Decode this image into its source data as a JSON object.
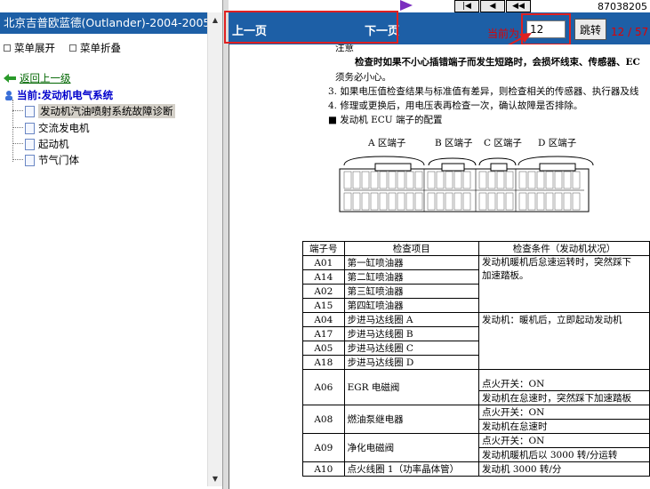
{
  "sidebar": {
    "title": "北京吉普欧蓝德(Outlander)-2004-2005",
    "expand_label": "菜单展开",
    "collapse_label": "菜单折叠",
    "back_label": "返回上一级",
    "current_label": "当前:发动机电气系统",
    "items": [
      {
        "label": "发动机汽油喷射系统故障诊断",
        "selected": true
      },
      {
        "label": "交流发电机",
        "selected": false
      },
      {
        "label": "起动机",
        "selected": false
      },
      {
        "label": "节气门体",
        "selected": false
      }
    ]
  },
  "toolbar": {
    "top_number": "87038205",
    "prev_label": "上一页",
    "next_label": "下一页",
    "page_label": "当前为",
    "page_value": "12",
    "jump_label": "跳转",
    "page_count": "12 / 57"
  },
  "document": {
    "note_heading": "注意",
    "note_line1": "检查时如果不小心插错端子而发生短路时，会损坏线束、传感器、EC",
    "note_line2": "须务必小心。",
    "step3": "3. 如果电压值检查结果与标准值有差异，则检查相关的传感器、执行器及线",
    "step4": "4. 修理或更换后，用电压表再检查一次，确认故障是否排除。",
    "section": "■ 发动机 ECU 端子的配置",
    "connectors": [
      "A 区端子",
      "B 区端子",
      "C 区端子",
      "D 区端子"
    ],
    "table_headers": [
      "端子号",
      "检查项目",
      "检查条件（发动机状况）"
    ],
    "rows": [
      {
        "pin": "A01",
        "item": "第一缸喷油器"
      },
      {
        "pin": "A14",
        "item": "第二缸喷油器"
      },
      {
        "pin": "A02",
        "item": "第三缸喷油器"
      },
      {
        "pin": "A15",
        "item": "第四缸喷油器"
      },
      {
        "pin": "A04",
        "item": "步进马达线圈 A"
      },
      {
        "pin": "A17",
        "item": "步进马达线圈 B"
      },
      {
        "pin": "A05",
        "item": "步进马达线圈 C"
      },
      {
        "pin": "A18",
        "item": "步进马达线圈 D"
      },
      {
        "pin": "A06",
        "item": "EGR 电磁阀"
      },
      {
        "pin": "A08",
        "item": "燃油泵继电器"
      },
      {
        "pin": "A09",
        "item": "净化电磁阀"
      },
      {
        "pin": "A10",
        "item": "点火线圈 1（功率晶体管）"
      }
    ],
    "conditions": {
      "injector_1": "发动机暖机后怠速运转时，突然踩下",
      "injector_2": "加速踏板。",
      "stepper": "发动机：暖机后，立即起动发动机",
      "egr_1": "点火开关：ON",
      "egr_2": "发动机在怠速时，突然踩下加速踏板",
      "fuel_1": "点火开关：ON",
      "fuel_2": "发动机在怠速时",
      "purge_1": "点火开关：ON",
      "purge_2": "发动机暖机后以 3000 转/分运转",
      "coil": "发动机 3000 转/分"
    }
  }
}
